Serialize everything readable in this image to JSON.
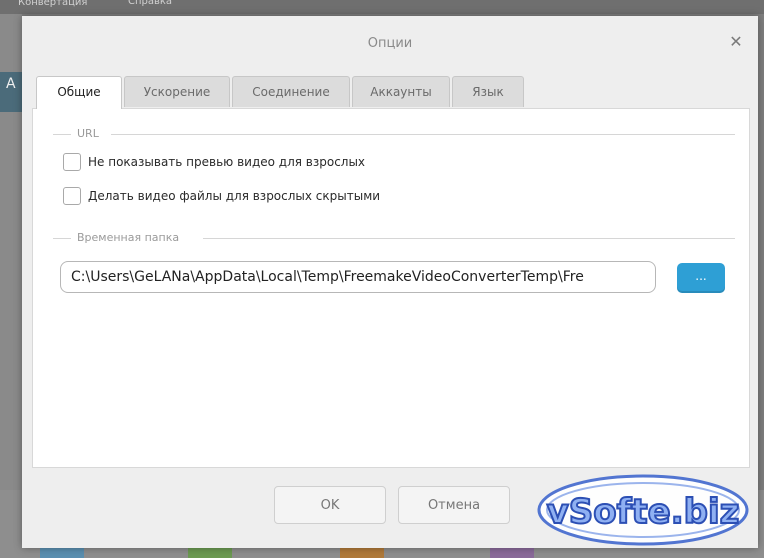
{
  "background_app": {
    "menu_items": [
      "Конвертация",
      "Справка"
    ],
    "left_letter": "А"
  },
  "dialog": {
    "title": "Опции",
    "close_glyph": "✕",
    "tabs": [
      {
        "label": "Общие",
        "active": true
      },
      {
        "label": "Ускорение",
        "active": false
      },
      {
        "label": "Соединение",
        "active": false
      },
      {
        "label": "Аккаунты",
        "active": false
      },
      {
        "label": "Язык",
        "active": false
      }
    ],
    "url_section": {
      "label": "URL",
      "checkboxes": [
        {
          "label": "Не показывать превью видео для взрослых",
          "checked": false
        },
        {
          "label": "Делать видео файлы для взрослых скрытыми",
          "checked": false
        }
      ]
    },
    "temp_section": {
      "label": "Временная папка",
      "path_value": "C:\\Users\\GeLANa\\AppData\\Local\\Temp\\FreemakeVideoConverterTemp\\Fre",
      "browse_label": "..."
    },
    "buttons": {
      "ok": "OK",
      "cancel": "Отмена"
    }
  },
  "watermark": {
    "text": "vSofte.biz"
  },
  "colors": {
    "accent": "#2e9fd5",
    "dialog_bg": "#eeeeee",
    "panel_bg": "#ffffff",
    "watermark_blue": "#3d68c9"
  }
}
